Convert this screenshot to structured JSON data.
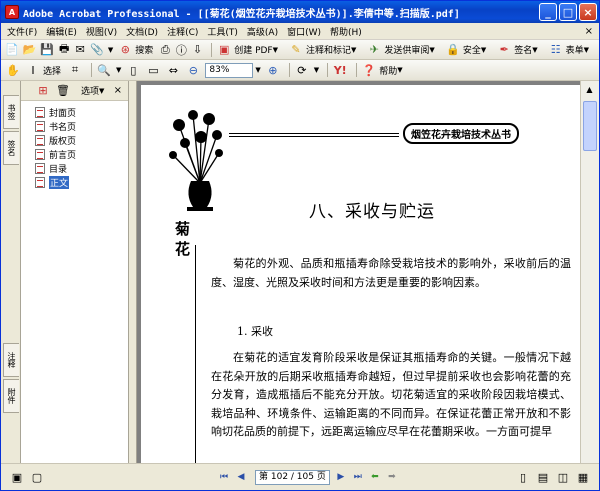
{
  "window": {
    "title": "Adobe Acrobat Professional - [[菊花(烟笠花卉栽培技术丛书)].李倩中等.扫描版.pdf]",
    "app_icon": "acrobat-icon",
    "buttons": {
      "minimize": "_",
      "maximize": "□",
      "close": "×"
    }
  },
  "menubar": {
    "items": [
      "文件(F)",
      "编辑(E)",
      "视图(V)",
      "文档(D)",
      "注释(C)",
      "工具(T)",
      "高级(A)",
      "窗口(W)",
      "帮助(H)"
    ],
    "close_glyph": "×"
  },
  "toolbar1": {
    "create_pdf": "创建 PDF",
    "comment": "注释和标记",
    "send_review": "发送供审阅",
    "security": "安全",
    "sign": "签名",
    "forms": "表单",
    "search_label": "搜索"
  },
  "toolbar2": {
    "select_label": "选择",
    "zoom_value": "83%",
    "help_label": "帮助"
  },
  "left_tabs": [
    "书签",
    "签名",
    "注释",
    "附件"
  ],
  "panel": {
    "options_label": "选项",
    "close_glyph": "×",
    "bookmarks": [
      {
        "label": "封面页",
        "selected": false
      },
      {
        "label": "书名页",
        "selected": false
      },
      {
        "label": "版权页",
        "selected": false
      },
      {
        "label": "前言页",
        "selected": false
      },
      {
        "label": "目录",
        "selected": false
      },
      {
        "label": "正文",
        "selected": true
      }
    ]
  },
  "page": {
    "series_title": "烟笠花卉栽培技术丛书",
    "side_chars": "菊花",
    "chapter_title": "八、采收与贮运",
    "paragraph1": "菊花的外观、品质和瓶插寿命除受栽培技术的影响外，采收前后的温度、湿度、光照及采收时间和方法更是重要的影响因素。",
    "section_heading": "1. 采收",
    "paragraph2": "在菊花的适宜发育阶段采收是保证其瓶插寿命的关键。一般情况下越在花朵开放的后期采收瓶插寿命越短，但过早提前采收也会影响花蕾的充分发育，造成瓶插后不能充分开放。切花菊适宜的采收阶段因栽培模式、栽培品种、环境条件、运输距离的不同而异。在保证花蕾正常开放和不影响切花品质的前提下，远距离运输应尽早在花蕾期采收。一方面可提早"
  },
  "statusbar": {
    "page_indicator": "第 102 / 105 页"
  },
  "colors": {
    "titlebar": "#0842c6",
    "selection": "#316ac5",
    "chrome": "#ece9d8"
  }
}
